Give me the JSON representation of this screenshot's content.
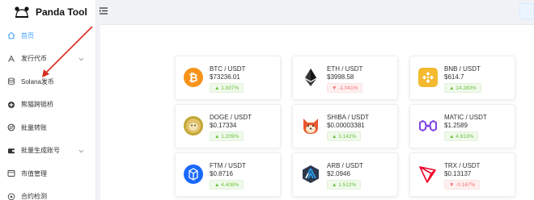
{
  "app": {
    "brand_name": "Panda Tool"
  },
  "sidebar": {
    "items": [
      {
        "label": "首页",
        "icon": "home-icon",
        "active": true,
        "expandable": false
      },
      {
        "label": "发行代币",
        "icon": "token-icon",
        "active": false,
        "expandable": true
      },
      {
        "label": "Solana发币",
        "icon": "database-icon",
        "active": false,
        "expandable": false
      },
      {
        "label": "熊猫跨链桥",
        "icon": "bridge-icon",
        "active": false,
        "expandable": false
      },
      {
        "label": "批量转账",
        "icon": "transfer-icon",
        "active": false,
        "expandable": false
      },
      {
        "label": "批量生成账号",
        "icon": "wallet-icon",
        "active": false,
        "expandable": true
      },
      {
        "label": "市值管理",
        "icon": "market-icon",
        "active": false,
        "expandable": false
      },
      {
        "label": "合约检测",
        "icon": "contract-check-icon",
        "active": false,
        "expandable": false
      }
    ]
  },
  "colors": {
    "accent": "#409eff",
    "up": "#67c23a",
    "down": "#f56c6c"
  },
  "cards": [
    {
      "pair": "BTC / USDT",
      "price": "$73236.01",
      "change": "1.937%",
      "dir": "up",
      "icon": "btc-icon"
    },
    {
      "pair": "ETH / USDT",
      "price": "$3998.58",
      "change": "-1.041%",
      "dir": "down",
      "icon": "eth-icon"
    },
    {
      "pair": "BNB / USDT",
      "price": "$614.7",
      "change": "14.280%",
      "dir": "up",
      "icon": "bnb-icon"
    },
    {
      "pair": "DOGE / USDT",
      "price": "$0.17334",
      "change": "1.209%",
      "dir": "up",
      "icon": "doge-icon"
    },
    {
      "pair": "SHIBA / USDT",
      "price": "$0.00003381",
      "change": "3.142%",
      "dir": "up",
      "icon": "shiba-icon"
    },
    {
      "pair": "MATIC / USDT",
      "price": "$1.2589",
      "change": "4.813%",
      "dir": "up",
      "icon": "matic-icon"
    },
    {
      "pair": "FTM / USDT",
      "price": "$0.8716",
      "change": "4.408%",
      "dir": "up",
      "icon": "ftm-icon"
    },
    {
      "pair": "ARB / USDT",
      "price": "$2.0946",
      "change": "1.512%",
      "dir": "up",
      "icon": "arb-icon"
    },
    {
      "pair": "TRX / USDT",
      "price": "$0.13137",
      "change": "-0.167%",
      "dir": "down",
      "icon": "trx-icon"
    }
  ]
}
